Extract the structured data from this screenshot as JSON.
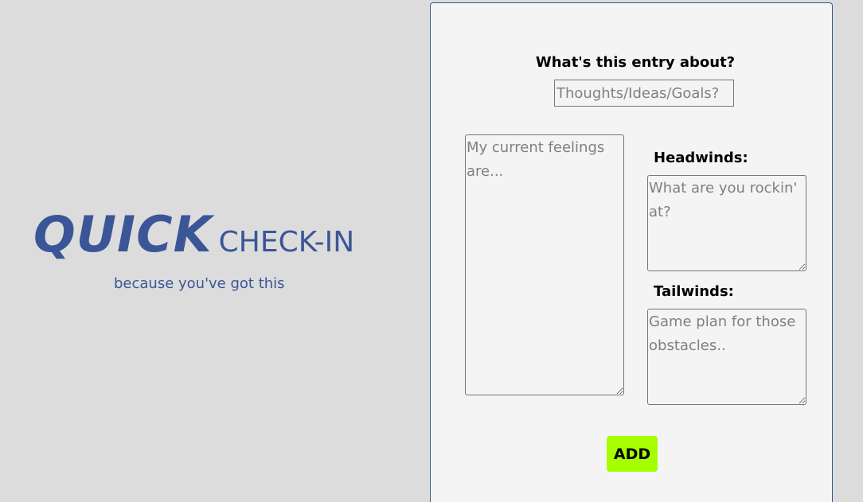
{
  "hero": {
    "title_primary": "QUICK",
    "title_secondary": "CHECK-IN",
    "tagline": "because you've got this"
  },
  "form": {
    "topic_label": "What's this entry about?",
    "topic_placeholder": "Thoughts/Ideas/Goals?",
    "feelings_placeholder": "My current feelings are...",
    "headwinds_label": "Headwinds:",
    "headwinds_placeholder": "What are you rockin' at?",
    "tailwinds_label": "Tailwinds:",
    "tailwinds_placeholder": "Game plan for those obstacles..",
    "add_label": "ADD"
  },
  "colors": {
    "brand": "#3a5697",
    "add_button": "#a6ff00",
    "page_background": "#dcdcdc",
    "card_background": "#f4f4f4"
  }
}
